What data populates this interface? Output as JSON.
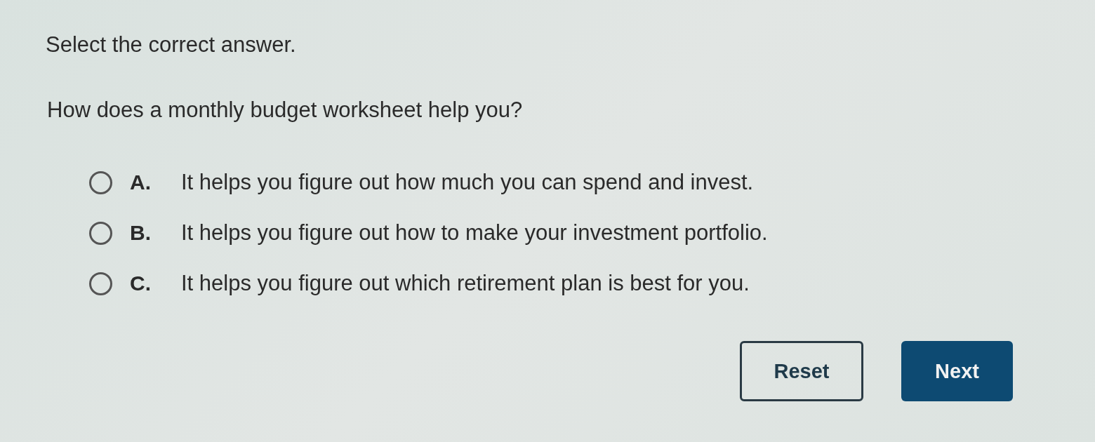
{
  "instruction": "Select the correct answer.",
  "question": "How does a monthly budget worksheet help you?",
  "options": [
    {
      "letter": "A.",
      "text": "It helps you figure out how much you can spend and invest.",
      "selected": false
    },
    {
      "letter": "B.",
      "text": "It helps you figure out how to make your investment portfolio.",
      "selected": false
    },
    {
      "letter": "C.",
      "text": "It helps you figure out which retirement plan is best for you.",
      "selected": false
    }
  ],
  "buttons": [
    {
      "kind": "secondary",
      "label": "Reset"
    },
    {
      "kind": "primary",
      "label": "Next"
    }
  ]
}
